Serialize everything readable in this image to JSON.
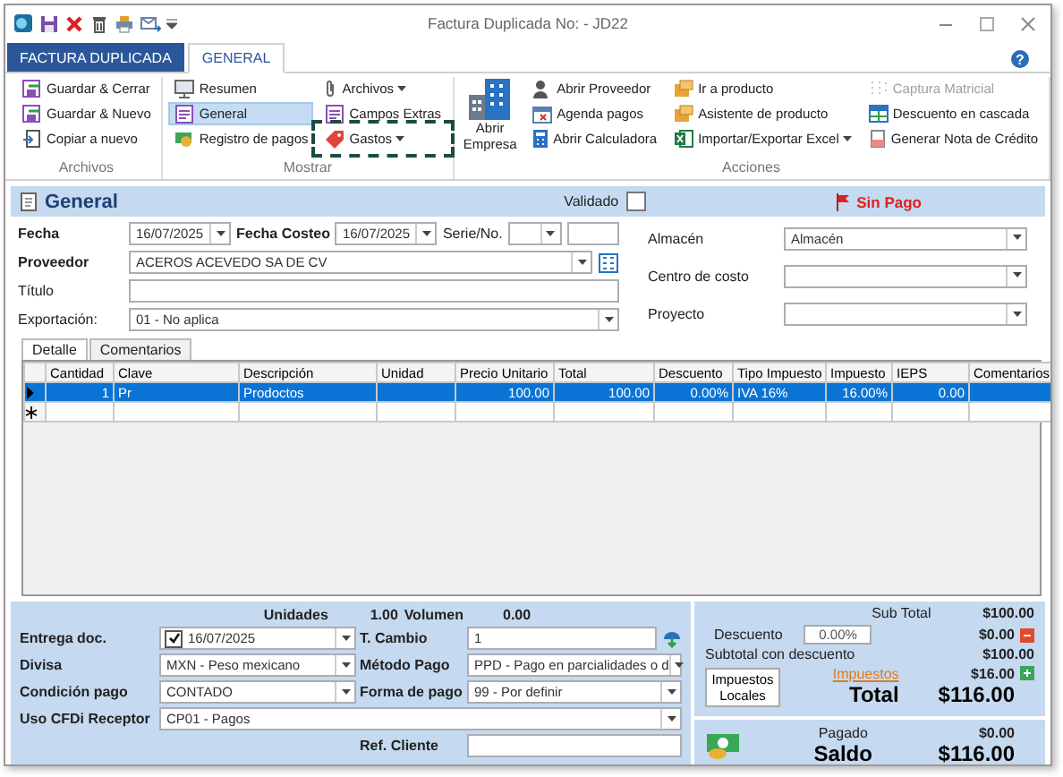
{
  "window": {
    "title": "Factura Duplicada No: - JD22"
  },
  "tabs": [
    {
      "label": "FACTURA DUPLICADA",
      "kind": "file",
      "selected": false
    },
    {
      "label": "GENERAL",
      "kind": "page",
      "selected": true
    }
  ],
  "help": "?",
  "ribbon": [
    {
      "label": "Archivos",
      "columns": [
        [
          {
            "label": "Guardar & Cerrar",
            "selected": false,
            "disabled": false,
            "dropdown": false,
            "highlighted": false
          },
          {
            "label": "Guardar & Nuevo",
            "selected": false,
            "disabled": false,
            "dropdown": false,
            "highlighted": false
          },
          {
            "label": "Copiar a nuevo",
            "selected": false,
            "disabled": false,
            "dropdown": false,
            "highlighted": false
          }
        ]
      ]
    },
    {
      "label": "Mostrar",
      "columns": [
        [
          {
            "label": "Resumen",
            "selected": false,
            "disabled": false,
            "dropdown": false,
            "highlighted": false
          },
          {
            "label": "General",
            "selected": true,
            "disabled": false,
            "dropdown": false,
            "highlighted": false
          },
          {
            "label": "Registro de pagos",
            "selected": false,
            "disabled": false,
            "dropdown": false,
            "highlighted": false
          }
        ],
        [
          {
            "label": "Archivos",
            "selected": false,
            "disabled": false,
            "dropdown": true,
            "highlighted": false
          },
          {
            "label": "Campos Extras",
            "selected": false,
            "disabled": false,
            "dropdown": false,
            "highlighted": false
          },
          {
            "label": "Gastos",
            "selected": false,
            "disabled": false,
            "dropdown": true,
            "highlighted": true
          }
        ]
      ]
    },
    {
      "label": "Acciones",
      "large": [
        {
          "label": "Abrir Empresa"
        }
      ],
      "columns": [
        [
          {
            "label": "Abrir Proveedor",
            "selected": false,
            "disabled": false,
            "dropdown": false,
            "highlighted": false
          },
          {
            "label": "Agenda pagos",
            "selected": false,
            "disabled": false,
            "dropdown": false,
            "highlighted": false
          },
          {
            "label": "Abrir Calculadora",
            "selected": false,
            "disabled": false,
            "dropdown": false,
            "highlighted": false
          }
        ],
        [
          {
            "label": "Ir a producto",
            "selected": false,
            "disabled": false,
            "dropdown": false,
            "highlighted": false
          },
          {
            "label": "Asistente de producto",
            "selected": false,
            "disabled": false,
            "dropdown": false,
            "highlighted": false
          },
          {
            "label": "Importar/Exportar Excel",
            "selected": false,
            "disabled": false,
            "dropdown": true,
            "highlighted": false
          }
        ],
        [
          {
            "label": "Captura Matricial",
            "selected": false,
            "disabled": true,
            "dropdown": false,
            "highlighted": false
          },
          {
            "label": "Descuento en cascada",
            "selected": false,
            "disabled": false,
            "dropdown": false,
            "highlighted": false
          },
          {
            "label": "Generar Nota de Crédito",
            "selected": false,
            "disabled": false,
            "dropdown": false,
            "highlighted": false
          }
        ]
      ]
    }
  ],
  "header": {
    "title": "General",
    "validado": {
      "label": "Validado",
      "checked": false
    },
    "status": {
      "label": "Sin Pago"
    }
  },
  "form": {
    "fecha": {
      "label": "Fecha",
      "value": "16/07/2025"
    },
    "fecha_costeo": {
      "label": "Fecha Costeo",
      "value": "16/07/2025"
    },
    "serie": {
      "label": "Serie/No."
    },
    "proveedor": {
      "label": "Proveedor",
      "value": "ACEROS ACEVEDO SA DE CV"
    },
    "titulo": {
      "label": "Título"
    },
    "exportacion": {
      "label": "Exportación:",
      "value": "01 - No aplica"
    },
    "almacen": {
      "label": "Almacén",
      "value": "Almacén"
    },
    "centro_costo": {
      "label": "Centro de costo"
    },
    "proyecto": {
      "label": "Proyecto"
    }
  },
  "detail_tabs": [
    {
      "label": "Detalle",
      "selected": true
    },
    {
      "label": "Comentarios",
      "selected": false
    }
  ],
  "table": {
    "columns": [
      "Cantidad",
      "Clave",
      "Descripción",
      "Unidad",
      "Precio Unitario",
      "Total",
      "Descuento",
      "Tipo Impuesto",
      "Impuesto",
      "IEPS",
      "Comentarios"
    ],
    "rows": [
      {
        "selected": true,
        "cells": [
          "1",
          "Pr",
          "Prodoctos",
          null,
          "100.00",
          "100.00",
          "0.00%",
          "IVA 16%",
          "16.00%",
          "0.00",
          null
        ]
      }
    ]
  },
  "summary": {
    "unidades": {
      "label": "Unidades",
      "value": "1.00"
    },
    "volumen": {
      "label": "Volumen",
      "value": "0.00"
    }
  },
  "payment": {
    "entrega": {
      "label": "Entrega doc.",
      "checked": true,
      "value": "16/07/2025"
    },
    "t_cambio": {
      "label": "T. Cambio",
      "value": "1"
    },
    "divisa": {
      "label": "Divisa",
      "value": "MXN - Peso mexicano"
    },
    "metodo_pago": {
      "label": "Método Pago",
      "value": "PPD - Pago en parcialidades o d"
    },
    "condicion_pago": {
      "label": "Condición pago",
      "value": "CONTADO"
    },
    "forma_pago": {
      "label": "Forma de pago",
      "value": "99 - Por definir"
    },
    "uso_cfdi": {
      "label": "Uso CFDi Receptor",
      "value": "CP01 - Pagos"
    },
    "ref_cliente": {
      "label": "Ref. Cliente"
    }
  },
  "totals": {
    "sub_total": {
      "label": "Sub Total",
      "value": "$100.00"
    },
    "descuento": {
      "label": "Descuento",
      "percent": "0.00%",
      "value": "$0.00"
    },
    "subtotal_descuento": {
      "label": "Subtotal con descuento",
      "value": "$100.00"
    },
    "impuestos_locales": "Impuestos Locales",
    "impuestos": {
      "label": "Impuestos",
      "value": "$16.00"
    },
    "total": {
      "label": "Total",
      "value": "$116.00"
    },
    "pagado": {
      "label": "Pagado",
      "value": "$0.00"
    },
    "saldo": {
      "label": "Saldo",
      "value": "$116.00"
    }
  }
}
